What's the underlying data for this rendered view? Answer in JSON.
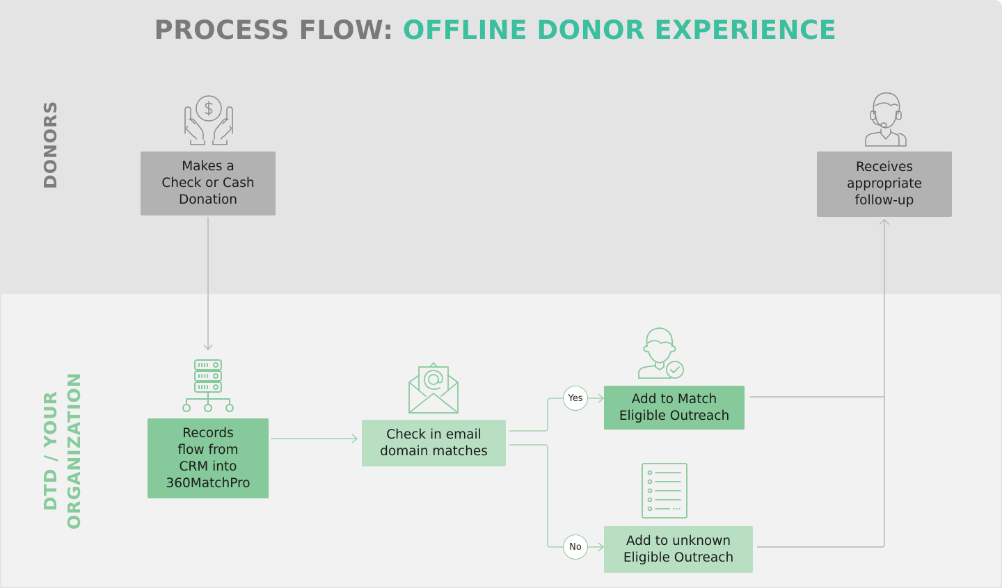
{
  "title": {
    "prefix": "PROCESS FLOW: ",
    "highlight": "OFFLINE DONOR EXPERIENCE"
  },
  "lanes": {
    "donors": "DONORS",
    "organization_line1": "DTD / YOUR",
    "organization_line2": "ORGANIZATION"
  },
  "nodes": {
    "donation": "Makes a\nCheck or Cash\nDonation",
    "followup": "Receives\nappropriate\nfollow-up",
    "records": "Records\nflow from\nCRM into\n360MatchPro",
    "check_email": "Check in email\ndomain matches",
    "match_eligible": "Add to Match\nEligible Outreach",
    "unknown_eligible": "Add to unknown\nEligible Outreach"
  },
  "decisions": {
    "yes": "Yes",
    "no": "No"
  },
  "icons": {
    "donation": "hands-coin-icon",
    "followup": "headset-agent-icon",
    "records": "server-network-icon",
    "check_email": "email-open-icon",
    "match_eligible": "user-check-icon",
    "unknown_eligible": "checklist-document-icon"
  },
  "colors": {
    "title_gray": "#7a7a7a",
    "title_accent": "#3bbf9e",
    "donor_box": "#b3b2b2",
    "org_box": "#86c99a",
    "org_box_light": "#b9dfc3",
    "connector_green": "#9fd3ad",
    "connector_gray": "#b8b8b8"
  }
}
